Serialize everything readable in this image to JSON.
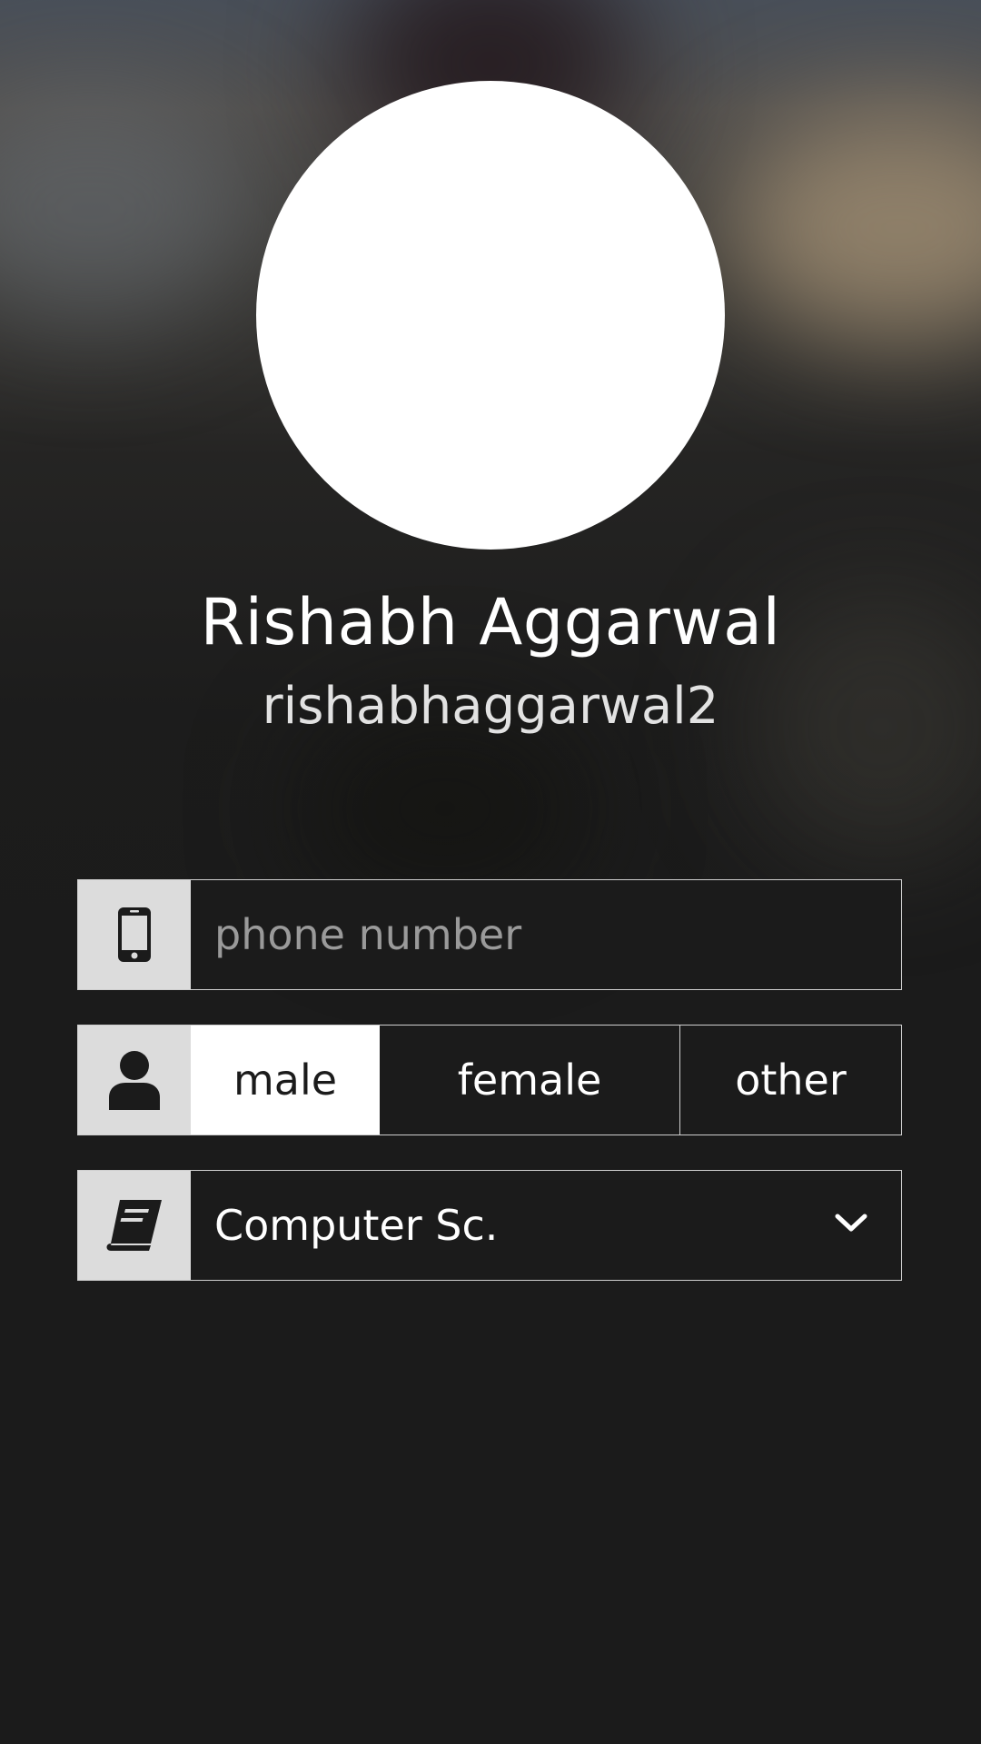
{
  "profile": {
    "name": "Rishabh Aggarwal",
    "username": "rishabhaggarwal2"
  },
  "phone": {
    "value": "",
    "placeholder": "phone number",
    "icon": "mobile-phone-icon"
  },
  "gender": {
    "icon": "user-icon",
    "options": [
      "male",
      "female",
      "other"
    ],
    "selected": "male"
  },
  "department": {
    "icon": "book-icon",
    "selected": "Computer Sc.",
    "dropdown_icon": "chevron-down-icon"
  },
  "colors": {
    "background": "#1b1b1b",
    "icon_cell": "#dcdcdc",
    "selected_option": "#ffffff",
    "border": "#cfcfcf"
  }
}
